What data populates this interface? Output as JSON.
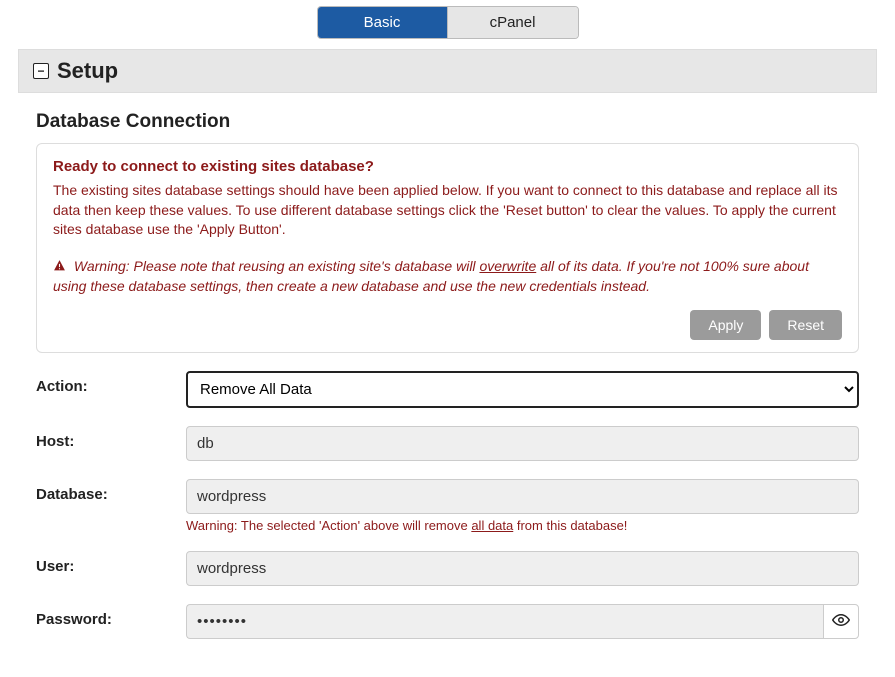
{
  "tabs": {
    "basic": "Basic",
    "cpanel": "cPanel"
  },
  "section": {
    "title": "Setup"
  },
  "subsection": {
    "title": "Database Connection"
  },
  "notice": {
    "title": "Ready to connect to existing sites database?",
    "text": "The existing sites database settings should have been applied below. If you want to connect to this database and replace all its data then keep these values. To use different database settings click the 'Reset button' to clear the values. To apply the current sites database use the 'Apply Button'.",
    "warning_prefix": "Warning: Please note that reusing an existing site's database will ",
    "warning_underline": "overwrite",
    "warning_suffix": " all of its data. If you're not 100% sure about using these database settings, then create a new database and use the new credentials instead.",
    "apply": "Apply",
    "reset": "Reset"
  },
  "form": {
    "action_label": "Action:",
    "action_value": "Remove All Data",
    "host_label": "Host:",
    "host_value": "db",
    "database_label": "Database:",
    "database_value": "wordpress",
    "database_warning_prefix": "Warning: The selected 'Action' above will remove ",
    "database_warning_underline": "all data",
    "database_warning_suffix": " from this database!",
    "user_label": "User:",
    "user_value": "wordpress",
    "password_label": "Password:",
    "password_value": "••••••••"
  }
}
